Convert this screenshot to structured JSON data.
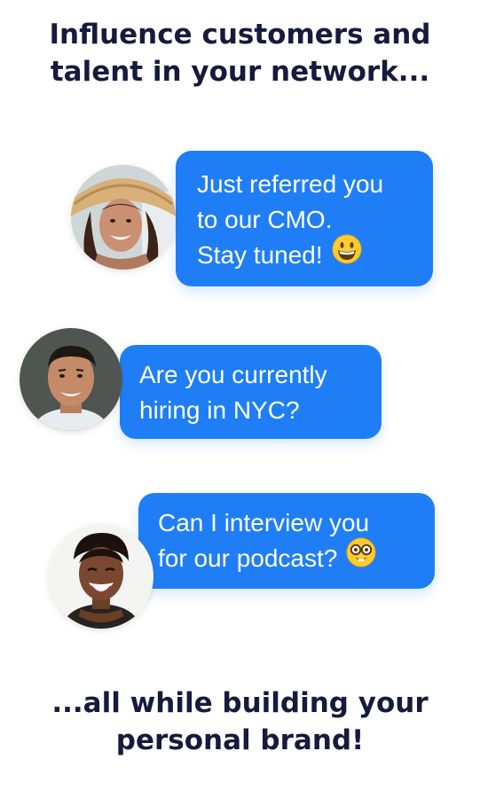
{
  "headline_top": {
    "line1": "Influence customers and",
    "line2": "talent in your network..."
  },
  "messages": [
    {
      "lines": [
        "Just referred you",
        "to our CMO.",
        "Stay tuned!"
      ],
      "emoji": "grinning-face-emoji",
      "avatar": "woman-straw-hat-avatar"
    },
    {
      "lines": [
        "Are you currently",
        "hiring in NYC?"
      ],
      "avatar": "man-smiling-avatar"
    },
    {
      "lines": [
        "Can I interview you",
        "for our podcast?"
      ],
      "emoji": "nerd-face-emoji",
      "avatar": "woman-laughing-avatar"
    }
  ],
  "headline_bottom": {
    "line1": "...all while building your",
    "line2": "personal brand!"
  },
  "colors": {
    "bubble": "#1f7ef6",
    "headline": "#161b3d",
    "background": "#ffffff"
  }
}
